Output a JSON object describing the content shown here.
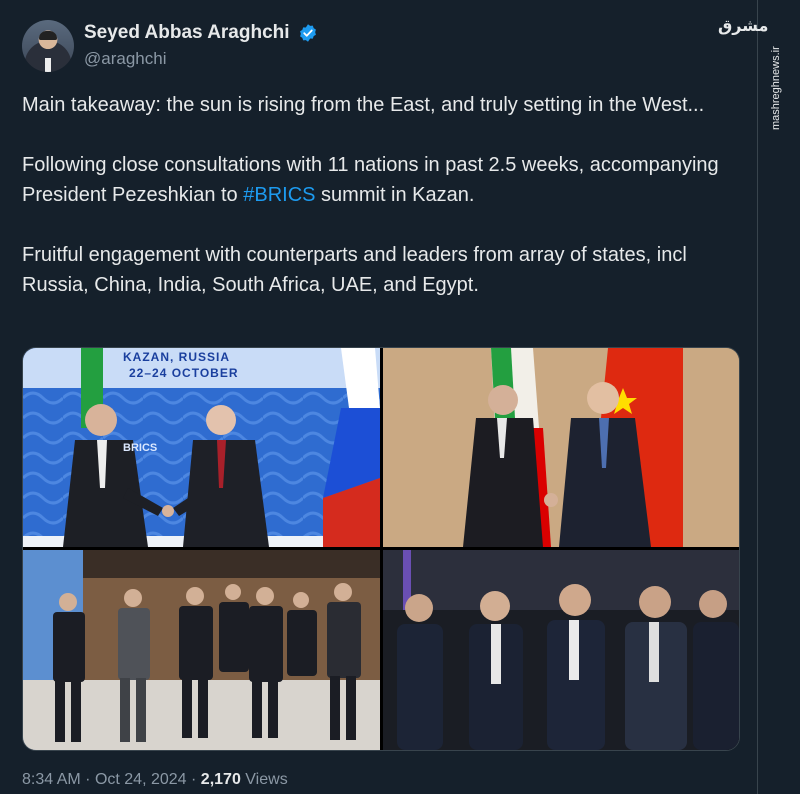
{
  "author": {
    "display_name": "Seyed Abbas Araghchi",
    "handle": "@araghchi",
    "verified": true,
    "verified_color": "#1d9bf0"
  },
  "watermark": {
    "logo": "مشرق",
    "site": "mashreghnews.ir"
  },
  "tweet": {
    "paragraph_1": "Main takeaway: the sun is rising from the East, and truly setting in the West...",
    "paragraph_2_before": "Following close consultations with 11 nations in past 2.5 weeks, accompanying President Pezeshkian to ",
    "paragraph_2_hashtag": "#BRICS",
    "paragraph_2_after": " summit in Kazan.",
    "paragraph_3": "Fruitful engagement with counterparts and leaders from array of states, incl Russia, China, India, South Africa, UAE, and Egypt."
  },
  "media": {
    "photo_1": {
      "banner_line_1": "KAZAN, RUSSIA",
      "banner_line_2": "22–24 OCTOBER",
      "logo_text": "BRICS"
    },
    "photo_2": {},
    "photo_3": {},
    "photo_4": {}
  },
  "footer": {
    "time": "8:34 AM",
    "separator": "·",
    "date": "Oct 24, 2024",
    "views_count": "2,170",
    "views_label": "Views"
  },
  "colors": {
    "background": "#15202b",
    "text": "#e7e9ea",
    "muted": "#8b98a5",
    "link": "#1d9bf0"
  }
}
